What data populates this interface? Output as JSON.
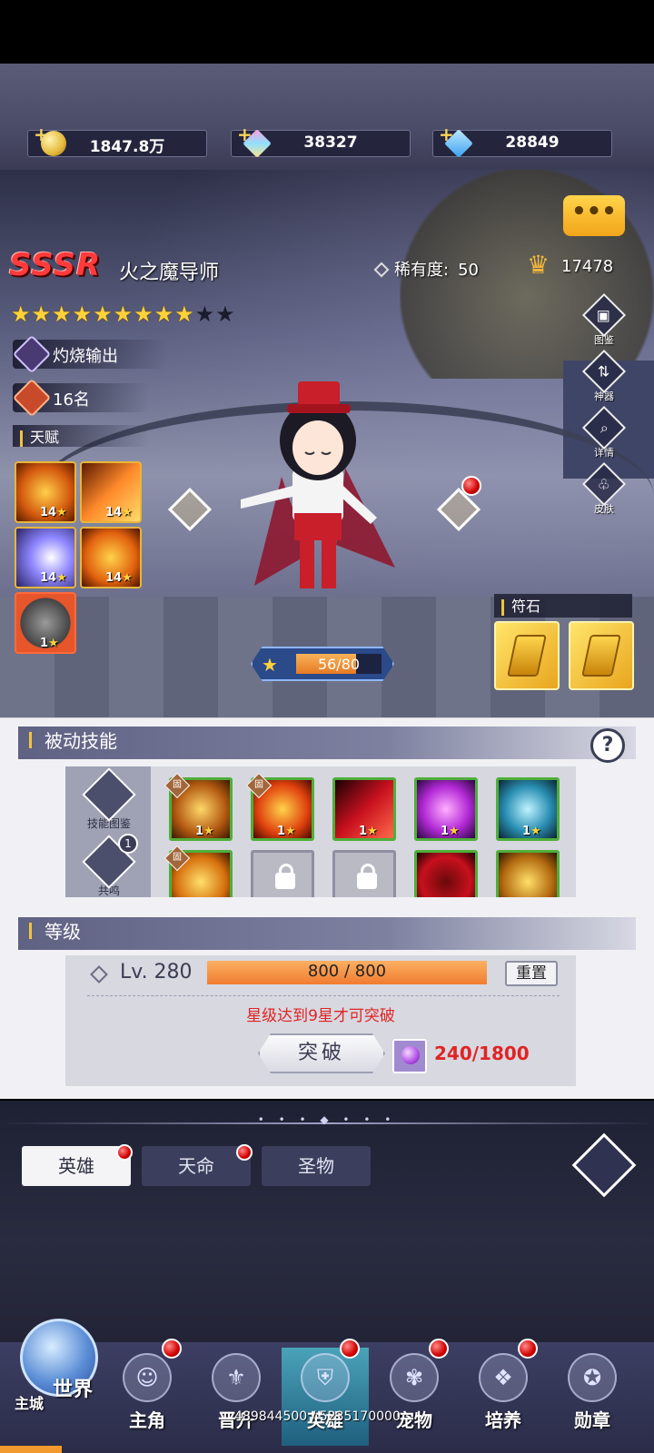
{
  "currencies": {
    "gold": "1847.8万",
    "crystal": "38327",
    "diamond": "28849"
  },
  "hero": {
    "rarity": "SSSR",
    "name": "火之魔导师",
    "rarity_label": "稀有度:",
    "rarity_value": "50",
    "power": "17478",
    "stars_filled": 9,
    "stars_total": 11,
    "role": "灼烧输出",
    "rank": "16名"
  },
  "talent": {
    "title": "天赋",
    "items": [
      {
        "level": "14"
      },
      {
        "level": "14"
      },
      {
        "level": "14"
      },
      {
        "level": "14"
      },
      {
        "level": "1"
      }
    ]
  },
  "side_buttons": [
    "图鉴",
    "神器",
    "详情",
    "皮肤"
  ],
  "runestone": {
    "title": "符石"
  },
  "exp_bar": {
    "text": "56/80",
    "current": 56,
    "max": 80
  },
  "passive": {
    "title": "被动技能",
    "help": "?",
    "codex_label": "技能图鉴",
    "resonance_label": "共鸣",
    "resonance_badge": "1",
    "skill_tag": "固",
    "skill_levels": [
      "1",
      "1",
      "1",
      "1",
      "1"
    ]
  },
  "level": {
    "title": "等级",
    "lv_text": "Lv. 280",
    "exp_text": "800 / 800",
    "exp_fraction": 1.0,
    "reset_label": "重置",
    "hint": "星级达到9星才可突破",
    "break_label": "突破",
    "cost": "240/1800"
  },
  "tabs": {
    "hero": "英雄",
    "fate": "天命",
    "relic": "圣物"
  },
  "nav": {
    "world": "世界",
    "main_city": "主城",
    "items": [
      {
        "label": "主角",
        "badge": true
      },
      {
        "label": "晋升",
        "badge": false
      },
      {
        "label": "英雄",
        "badge": true
      },
      {
        "label": "宠物",
        "badge": true
      },
      {
        "label": "培养",
        "badge": true
      },
      {
        "label": "勋章",
        "badge": false
      }
    ]
  },
  "memory_text": "489844500 / 5235170000",
  "colors": {
    "accent_gold": "#f0c540",
    "red_text": "#e02424",
    "exp_orange": "#f07c30"
  }
}
